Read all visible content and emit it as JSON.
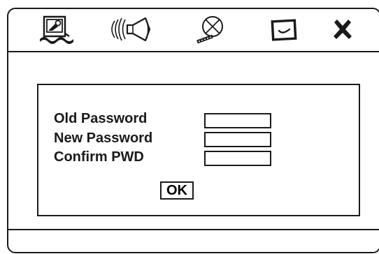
{
  "toolbar": {
    "tabs": [
      {
        "id": "system",
        "icon": "system-setup-icon"
      },
      {
        "id": "audio",
        "icon": "speaker-icon"
      },
      {
        "id": "video",
        "icon": "video-icon"
      },
      {
        "id": "preference",
        "icon": "checkbox-icon"
      },
      {
        "id": "exit",
        "icon": "close-icon"
      }
    ]
  },
  "password_dialog": {
    "old_password_label": "Old Password",
    "new_password_label": "New Password",
    "confirm_label": "Confirm PWD",
    "old_password_value": "",
    "new_password_value": "",
    "confirm_value": "",
    "ok_label": "OK"
  },
  "colors": {
    "line": "#1a1a1a",
    "background": "#ffffff"
  }
}
